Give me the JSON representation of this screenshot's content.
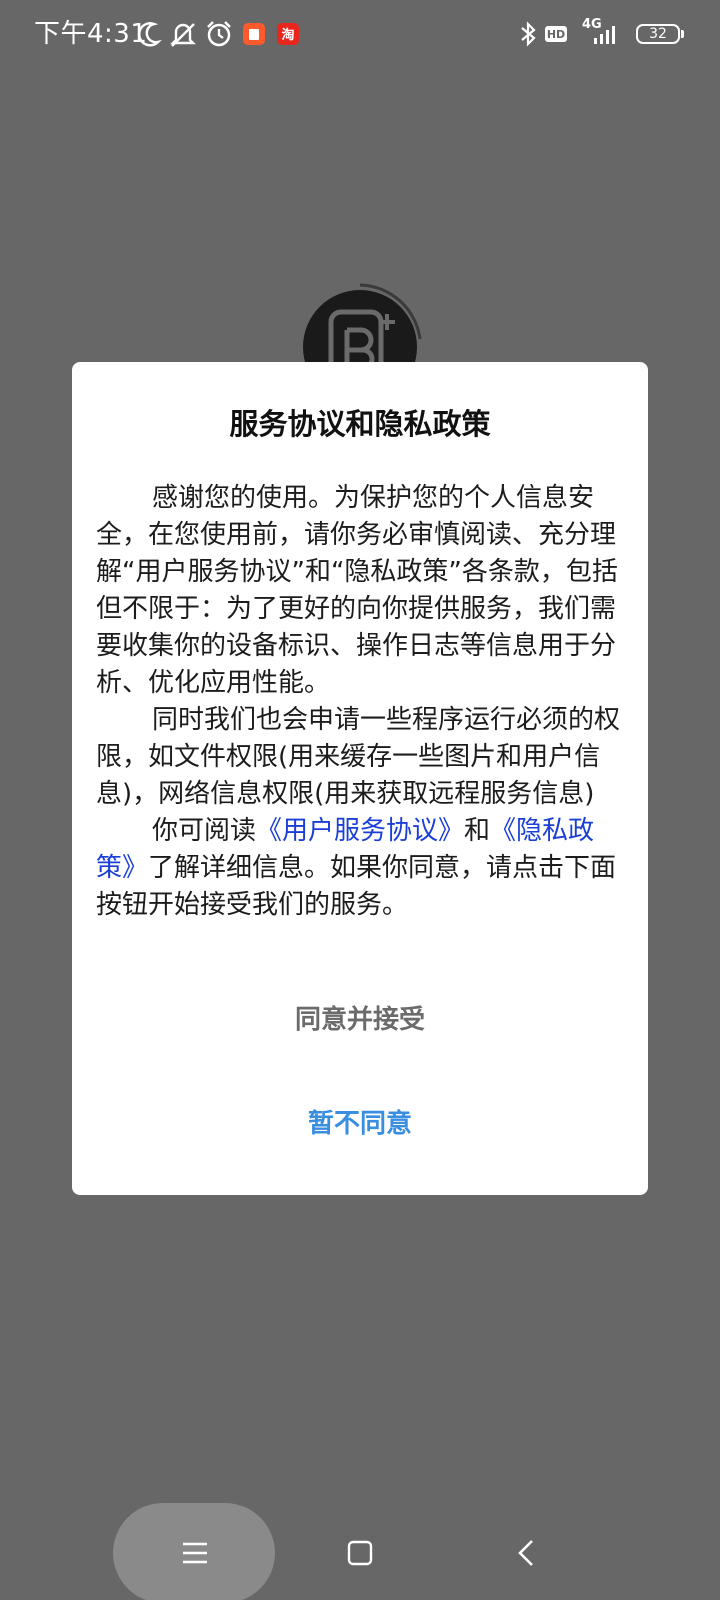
{
  "status_bar": {
    "time": "下午4:31",
    "network": "4G",
    "battery": "32",
    "icons": [
      "moon-icon",
      "bell-muted-icon",
      "alarm-icon",
      "app-notification-icon",
      "taobao-app-icon",
      "bluetooth-icon",
      "hd-icon",
      "signal-icon",
      "battery-icon"
    ]
  },
  "dialog": {
    "title": "服务协议和隐私政策",
    "paragraph1": "感谢您的使用。为保护您的个人信息安全，在您使用前，请你务必审慎阅读、充分理解“用户服务协议”和“隐私政策”各条款，包括但不限于：为了更好的向你提供服务，我们需要收集你的设备标识、操作日志等信息用于分析、优化应用性能。",
    "paragraph2": "同时我们也会申请一些程序运行必须的权限，如文件权限(用来缓存一些图片和用户信息)，网络信息权限(用来获取远程服务信息)",
    "paragraph3_prefix": "你可阅读",
    "link_user_agreement": "《用户服务协议》",
    "paragraph3_and": "和",
    "link_privacy_policy": "《隐私政策》",
    "paragraph3_suffix": "了解详细信息。如果你同意，请点击下面按钮开始接受我们的服务。",
    "agree_button": "同意并接受",
    "disagree_button": "暂不同意"
  },
  "nav_bar": {
    "buttons": [
      "menu-icon",
      "home-icon",
      "back-icon"
    ]
  },
  "colors": {
    "overlay": "#676767",
    "link": "#1b3fd6",
    "disagree": "#3a8ee0",
    "agree": "#6b6b6b"
  }
}
